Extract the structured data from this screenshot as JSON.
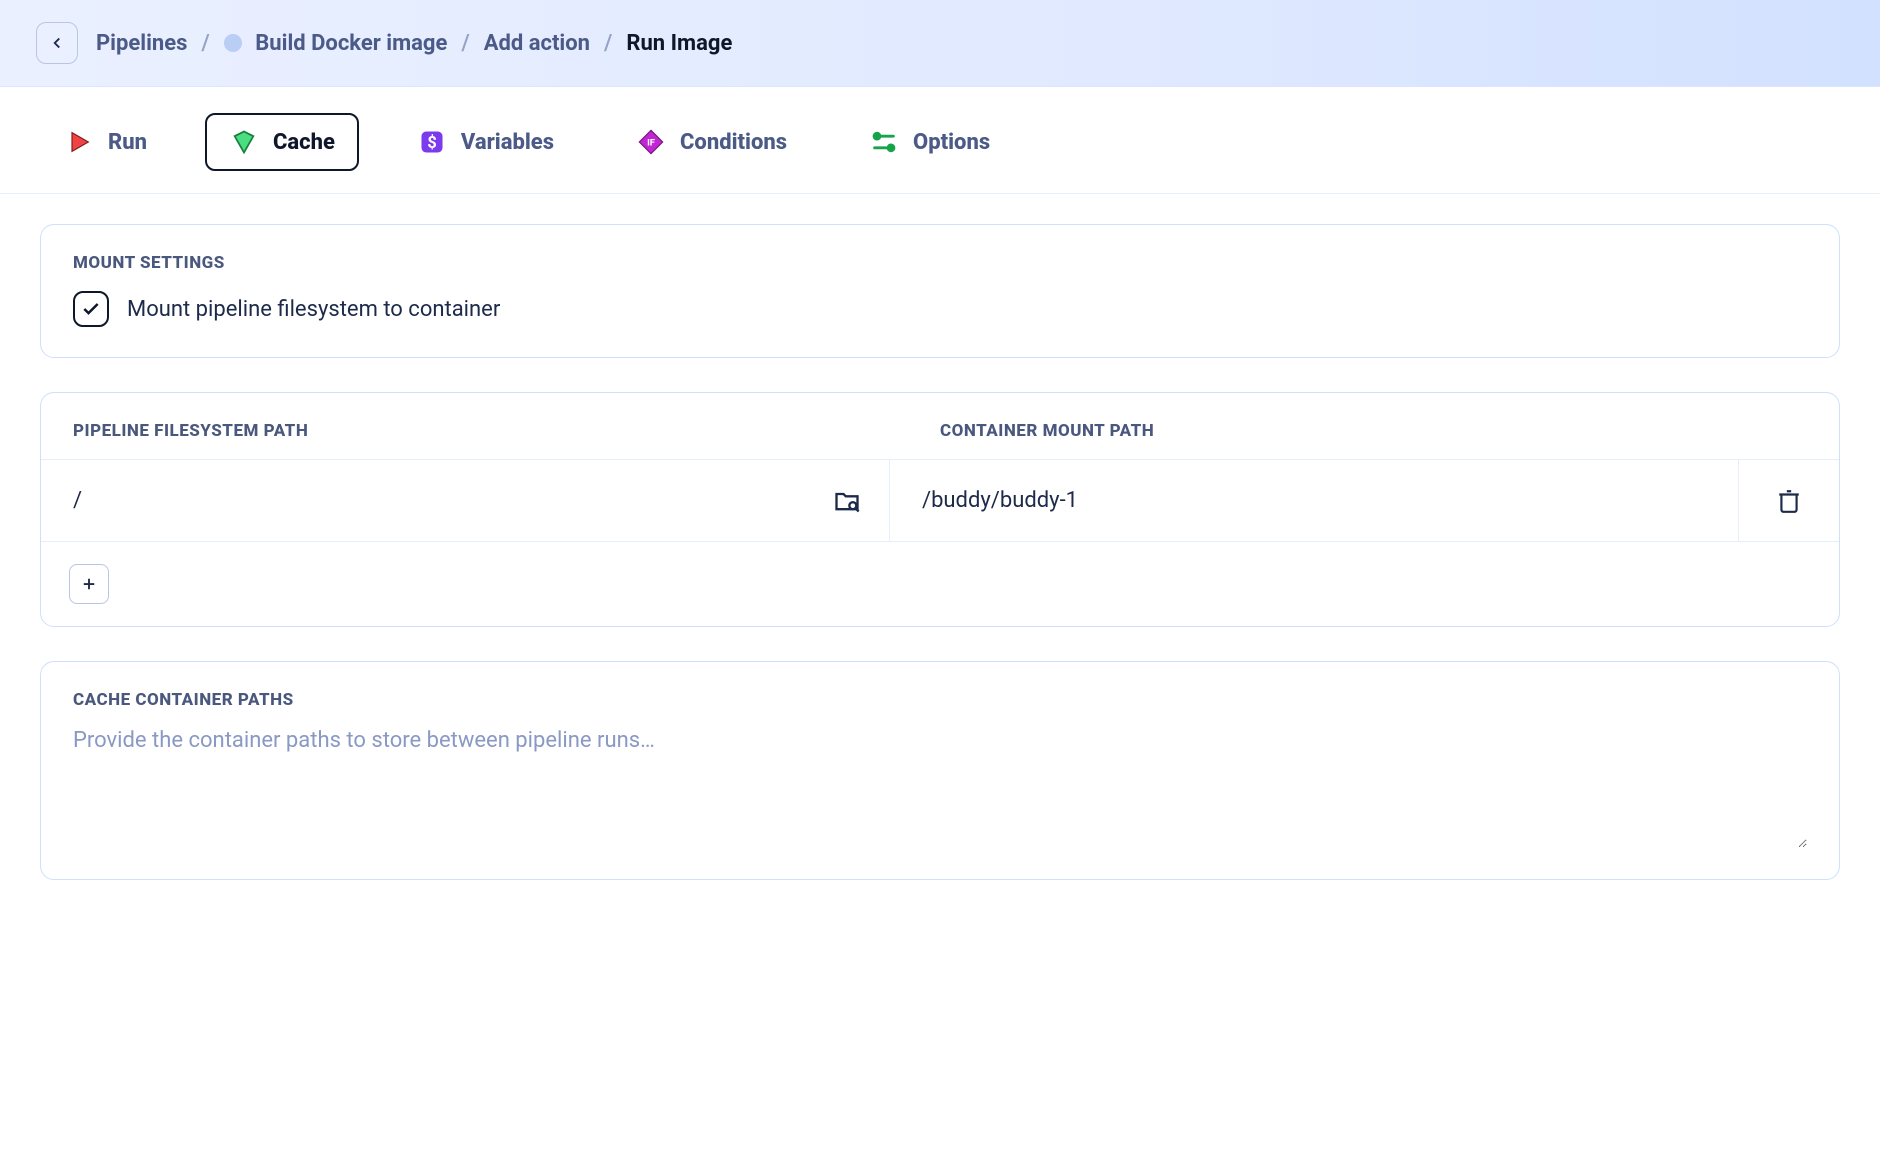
{
  "breadcrumbs": {
    "items": [
      {
        "label": "Pipelines",
        "hasDot": false
      },
      {
        "label": "Build Docker image",
        "hasDot": true
      },
      {
        "label": "Add action",
        "hasDot": false
      },
      {
        "label": "Run Image",
        "hasDot": false,
        "current": true
      }
    ]
  },
  "tabs": [
    {
      "id": "run",
      "label": "Run",
      "icon": "play-icon",
      "color": "#ef4444"
    },
    {
      "id": "cache",
      "label": "Cache",
      "icon": "shield-icon",
      "color": "#22c55e",
      "active": true
    },
    {
      "id": "variables",
      "label": "Variables",
      "icon": "dollar-icon",
      "color": "#6d28d9"
    },
    {
      "id": "conditions",
      "label": "Conditions",
      "icon": "if-icon",
      "color": "#a21caf"
    },
    {
      "id": "options",
      "label": "Options",
      "icon": "settings-icon",
      "color": "#16a34a"
    }
  ],
  "mountSettings": {
    "title": "Mount Settings",
    "checkboxLabel": "Mount pipeline filesystem to container",
    "checked": true
  },
  "pathTable": {
    "headers": {
      "fs": "Pipeline Filesystem Path",
      "container": "Container Mount Path"
    },
    "rows": [
      {
        "fs": "/",
        "container": "/buddy/buddy-1"
      }
    ]
  },
  "cachePaths": {
    "title": "Cache Container Paths",
    "placeholder": "Provide the container paths to store between pipeline runs…",
    "value": ""
  }
}
